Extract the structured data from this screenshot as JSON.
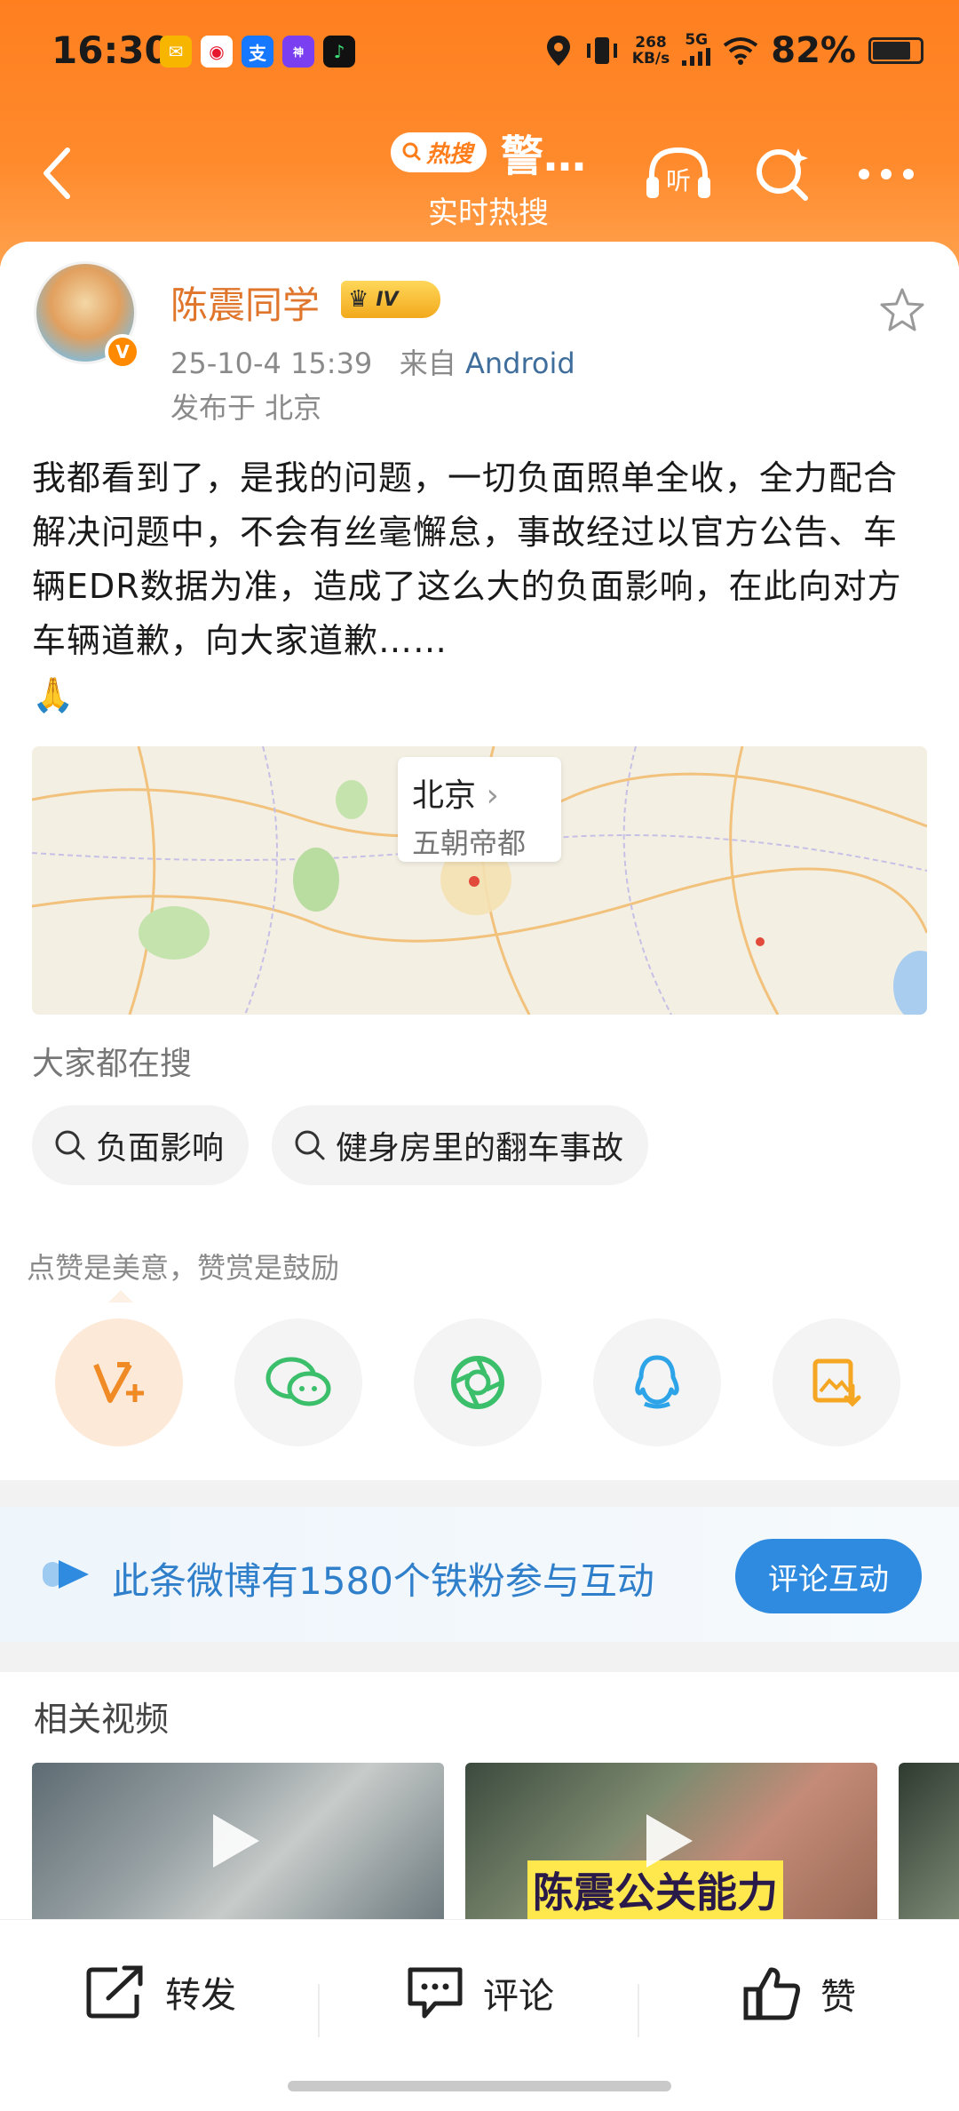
{
  "status_bar": {
    "time": "16:30",
    "net_speed_value": "268",
    "net_speed_unit": "KB/s",
    "signal": "5G",
    "battery": "82%",
    "app_icons": [
      "mail-app-icon",
      "weibo-app-icon",
      "alipay-app-icon",
      "shenpai-app-icon",
      "music-app-icon"
    ]
  },
  "nav": {
    "hot_badge": "热搜",
    "title": "警…",
    "subtitle": "实时热搜",
    "listen_label": "听"
  },
  "post": {
    "username": "陈震同学",
    "level": "IV",
    "date": "25-10-4 15:39",
    "source_prefix": "来自",
    "source": "Android",
    "location": "发布于 北京",
    "content": "我都看到了，是我的问题，一切负面照单全收，全力配合解决问题中，不会有丝毫懈怠，事故经过以官方公告、车辆EDR数据为准，造成了这么大的负面影响，在此向对方车辆道歉，向大家道歉……",
    "content_emoji": "🙏",
    "map_city": "北京",
    "map_desc": "五朝帝都"
  },
  "search": {
    "label": "大家都在搜",
    "chips": [
      "负面影响",
      "健身房里的翻车事故"
    ]
  },
  "share": {
    "tip": "点赞是美意，赞赏是鼓励",
    "buttons": [
      "reward-icon",
      "wechat-icon",
      "moments-icon",
      "qq-icon",
      "save-image-icon"
    ]
  },
  "fans": {
    "text": "此条微博有1580个铁粉参与互动",
    "button": "评论互动"
  },
  "related": {
    "title": "相关视频",
    "video2_caption": "陈震公关能力"
  },
  "bottom": {
    "repost": "转发",
    "comment": "评论",
    "like": "赞"
  },
  "colors": {
    "header_orange": "#ff7f1f",
    "username_orange": "#e0752c",
    "link_blue": "#3f6e9c",
    "fans_blue": "#2f7fcb"
  }
}
